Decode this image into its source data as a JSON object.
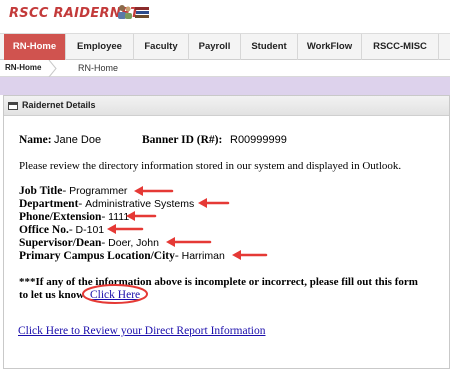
{
  "header": {
    "logo_text": "RSCC RAIDERNET",
    "logo_icon_1": "people-icon",
    "logo_icon_2": "books-icon"
  },
  "nav": {
    "tabs": [
      {
        "label": "RN-Home",
        "active": true
      },
      {
        "label": "Employee"
      },
      {
        "label": "Faculty"
      },
      {
        "label": "Payroll"
      },
      {
        "label": "Student"
      },
      {
        "label": "WorkFlow"
      },
      {
        "label": "RSCC-MISC"
      }
    ]
  },
  "breadcrumb": {
    "root": "RN-Home",
    "current": "RN-Home"
  },
  "panel": {
    "title": "Raidernet Details",
    "name_label": "Name:",
    "name_value": "Jane Doe",
    "banner_label": "Banner ID (R#):",
    "banner_value": "R00999999",
    "intro": "Please review the directory information stored in our system and displayed in Outlook.",
    "fields": [
      {
        "label": "Job Title",
        "sep": "- ",
        "value": "Programmer"
      },
      {
        "label": "Department",
        "sep": "- ",
        "value": "Administrative Systems"
      },
      {
        "label": "Phone/Extension",
        "sep": "- ",
        "value": "1111"
      },
      {
        "label": "Office No.",
        "sep": "- ",
        "value": "D-101"
      },
      {
        "label": "Supervisor/Dean",
        "sep": "- ",
        "value": "Doer, John"
      },
      {
        "label": "Primary Campus Location/City",
        "sep": "- ",
        "value": "Harriman"
      }
    ],
    "notice_line1": "***If any of the information above is incomplete or incorrect, please fill out this form",
    "notice_line2": "to let us know",
    "click_here": "Click Here",
    "direct_report_link": "Click Here to Review your Direct Report Information"
  },
  "colors": {
    "nav_active": "#d0534f",
    "annotation": "#e53935",
    "link": "#1a0dab",
    "band": "#ddd2ec"
  }
}
